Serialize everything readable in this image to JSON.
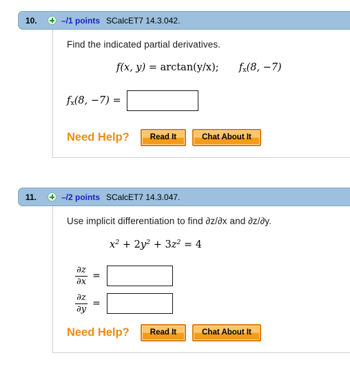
{
  "problems": [
    {
      "number": "10.",
      "plus_icon": "plus-circle-icon",
      "points": "–/1 points",
      "source": "SCalcET7 14.3.042.",
      "question": "Find the indicated partial derivatives.",
      "equation": {
        "fn": "f",
        "args": "(x, y)",
        "equals": "=",
        "rhs": "arctan(y/x);",
        "second": "f",
        "second_sub": "x",
        "second_args": "(8, −7)"
      },
      "answer_label": {
        "fn": "f",
        "sub": "x",
        "args": "(8, −7)",
        "equals": "="
      },
      "answer_value": "",
      "need_help_label": "Need Help?",
      "buttons": [
        {
          "label": "Read It",
          "name": "read-it-button"
        },
        {
          "label": "Chat About It",
          "name": "chat-about-it-button"
        }
      ]
    },
    {
      "number": "11.",
      "plus_icon": "plus-circle-icon",
      "points": "–/2 points",
      "source": "SCalcET7 14.3.047.",
      "question": "Use implicit differentiation to find  ∂z/∂x and ∂z/∂y.",
      "equation": {
        "x_term": "x",
        "x_pow": "2",
        "plus1": "+",
        "y_coef": "2",
        "y_term": "y",
        "y_pow": "2",
        "plus2": "+",
        "z_coef": "3",
        "z_term": "z",
        "z_pow": "2",
        "equals": "=",
        "rhs": "4"
      },
      "fractions": [
        {
          "num": "∂z",
          "den": "∂x",
          "equals": "=",
          "value": "",
          "name": "partial-z-partial-x"
        },
        {
          "num": "∂z",
          "den": "∂y",
          "equals": "=",
          "value": "",
          "name": "partial-z-partial-y"
        }
      ],
      "need_help_label": "Need Help?",
      "buttons": [
        {
          "label": "Read It",
          "name": "read-it-button"
        },
        {
          "label": "Chat About It",
          "name": "chat-about-it-button"
        }
      ]
    }
  ],
  "colors": {
    "header_bar": "#9cc0dd",
    "points_text": "#1a20c8",
    "need_help": "#ee8b10",
    "button_border": "#e07b10",
    "plus_green": "#1c9a1c"
  }
}
